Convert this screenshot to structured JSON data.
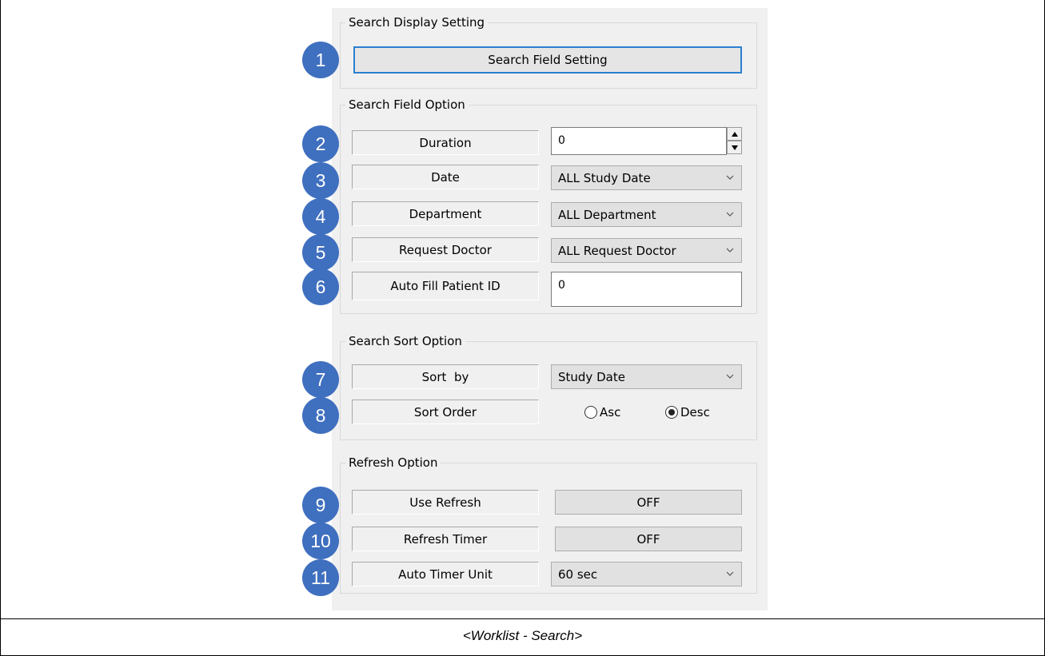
{
  "groups": {
    "display": "Search Display Setting",
    "field": "Search Field Option",
    "sort": "Search Sort Option",
    "refresh": "Refresh Option"
  },
  "badges": [
    "1",
    "2",
    "3",
    "4",
    "5",
    "6",
    "7",
    "8",
    "9",
    "10",
    "11"
  ],
  "search_field_setting_button": "Search Field Setting",
  "fields": {
    "duration": {
      "label": "Duration",
      "value": "0"
    },
    "date": {
      "label": "Date",
      "value": "ALL Study Date"
    },
    "department": {
      "label": "Department",
      "value": "ALL Department"
    },
    "request_doctor": {
      "label": "Request Doctor",
      "value": "ALL Request Doctor"
    },
    "auto_fill": {
      "label": "Auto Fill Patient ID",
      "value": "0"
    }
  },
  "sort": {
    "sort_by": {
      "label": "Sort  by",
      "value": "Study Date"
    },
    "sort_order": {
      "label": "Sort Order",
      "asc": "Asc",
      "desc": "Desc",
      "selected": "Desc"
    }
  },
  "refresh": {
    "use_refresh": {
      "label": "Use Refresh",
      "value": "OFF"
    },
    "refresh_timer": {
      "label": "Refresh Timer",
      "value": "OFF"
    },
    "auto_timer_unit": {
      "label": "Auto Timer Unit",
      "value": "60 sec"
    }
  },
  "caption": "<Worklist - Search>",
  "colors": {
    "badge": "#3f6fbf",
    "button_border": "#2a7fd0",
    "panel": "#f0f0f0"
  },
  "icons": [
    "chevron-down-icon",
    "spin-up-icon",
    "spin-down-icon"
  ]
}
